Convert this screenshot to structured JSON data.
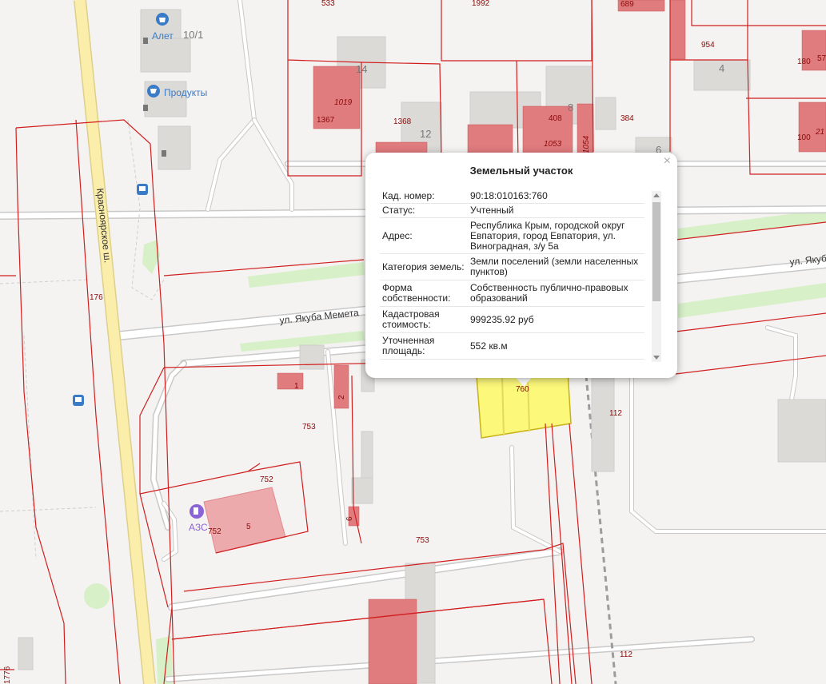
{
  "map": {
    "streets": {
      "krasnoyarskoe": "Красноярское ш.",
      "yakuba_memeta": "ул. Якуба Мемета",
      "yakuba_cut": "ул. Якуб"
    },
    "poi": {
      "alet": "Алет",
      "produkty": "Продукты",
      "azs": "АЗС"
    },
    "house_numbers": {
      "h10_1": "10/1",
      "h14": "14",
      "h12": "12",
      "h8": "8",
      "h4": "4",
      "h6": "6"
    },
    "parcel_labels": {
      "p533": "533",
      "p1992": "1992",
      "p689": "689",
      "p954": "954",
      "p180": "180",
      "p57": "57",
      "p1019": "1019",
      "p1367": "1367",
      "p1368": "1368",
      "p408": "408",
      "p1053": "1053",
      "p1054": "1054",
      "p384": "384",
      "p100": "100",
      "p21": "21",
      "p176": "176",
      "p1": "1",
      "p2": "2",
      "p753a": "753",
      "p752a": "752",
      "p752b": "752",
      "p5": "5",
      "p6": "6",
      "p753b": "753",
      "p760": "760",
      "p112a": "112",
      "p112b": "112",
      "p1776": "1776"
    },
    "colors": {
      "building_fill": "#e07b7e",
      "parcel_line": "#d11f1f",
      "selected_parcel": "#fbf87a",
      "main_road": "#fbeeaa",
      "green": "#d7f0c8"
    }
  },
  "popup": {
    "title": "Земельный участок",
    "close": "×",
    "rows": [
      {
        "key": "Кад. номер:",
        "value": "90:18:010163:760"
      },
      {
        "key": "Статус:",
        "value": "Учтенный"
      },
      {
        "key": "Адрес:",
        "value": "Республика Крым, городской округ Евпатория, город Евпатория, ул. Виноградная, з/у 5а"
      },
      {
        "key": "Категория земель:",
        "value": "Земли поселений (земли населенных пунктов)"
      },
      {
        "key": "Форма собственности:",
        "value": "Собственность публично-правовых образований"
      },
      {
        "key": "Кадастровая стоимость:",
        "value": "999235.92 руб"
      },
      {
        "key": "Уточненная площадь:",
        "value": "552 кв.м"
      }
    ]
  }
}
